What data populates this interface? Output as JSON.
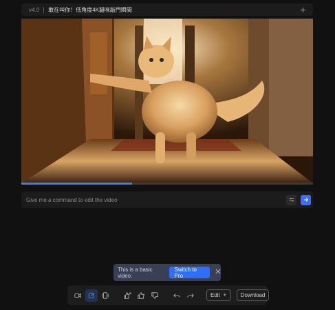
{
  "header": {
    "version": "v4.0",
    "title": "敢在叫你！低角度4K貓咪敲門瞬間"
  },
  "video": {
    "description_icon": "video-frame",
    "progress": 0.38
  },
  "command": {
    "placeholder": "Give me a command to edit the video"
  },
  "toast": {
    "message": "This is a basic video.",
    "cta_label": "Switch to Pro",
    "close_icon": "x"
  },
  "toolbar": {
    "edit_label": "Edit",
    "download_label": "Download"
  },
  "colors": {
    "accent": "#3b6ef5",
    "background": "#111111",
    "panel": "#1c1c1c",
    "toast": "#3a3f55"
  }
}
